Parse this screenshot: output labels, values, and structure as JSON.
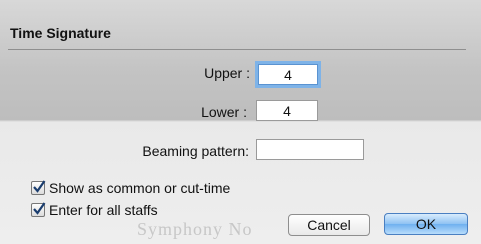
{
  "dialog": {
    "title": "Time Signature",
    "upper_label": "Upper :",
    "upper_value": "4",
    "lower_label": "Lower :",
    "lower_value": "4",
    "beaming_label": "Beaming pattern:",
    "beaming_value": "",
    "common_time_label": "Show as common or cut-time",
    "common_time_checked": true,
    "all_staffs_label": "Enter for all staffs",
    "all_staffs_checked": true,
    "cancel_label": "Cancel",
    "ok_label": "OK",
    "background_text": "Symphony No"
  },
  "colors": {
    "focus_ring": "#7eb3e8",
    "default_button": "#8ec2f3"
  }
}
